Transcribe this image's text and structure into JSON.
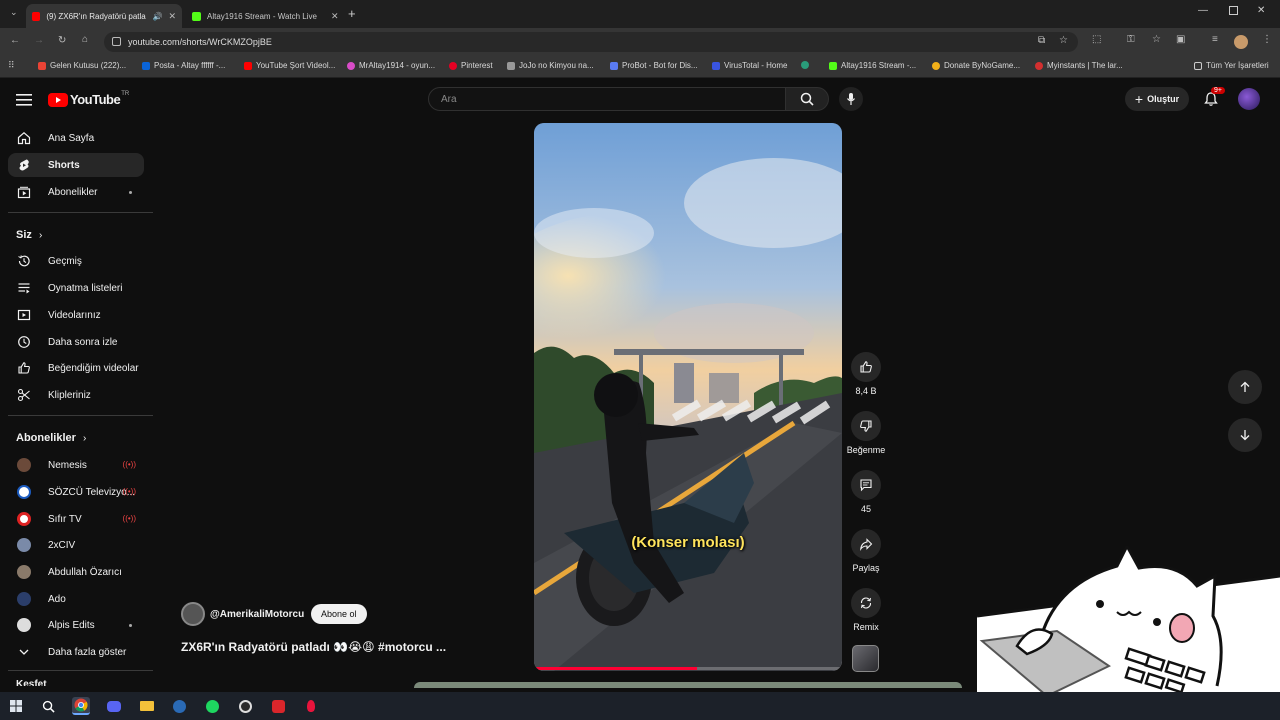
{
  "browser": {
    "tabs": [
      {
        "title": "(9) ZX6R'ın Radyatörü patla",
        "active": true
      },
      {
        "title": "Altay1916 Stream - Watch Live",
        "active": false
      }
    ],
    "url": "youtube.com/shorts/WrCKMZOpjBE",
    "bookmarks": [
      "Gelen Kutusu (222)...",
      "Posta - Altay ffffff -...",
      "YouTube Şort Videol...",
      "MrAltay1914 - oyun...",
      "Pinterest",
      "JoJo no Kimyou na...",
      "ProBot - Bot for Dis...",
      "VirusTotal - Home",
      "",
      "Altay1916 Stream -...",
      "Donate ByNoGame...",
      "Myinstants | The lar...",
      "Tüm Yer İşaretleri"
    ]
  },
  "youtube": {
    "logo": "YouTube",
    "country": "TR",
    "search_placeholder": "Ara",
    "create_label": "Oluştur",
    "notif_badge": "9+",
    "sidebar": {
      "main": [
        "Ana Sayfa",
        "Shorts",
        "Abonelikler"
      ],
      "you_header": "Siz",
      "you": [
        "Geçmiş",
        "Oynatma listeleri",
        "Videolarınız",
        "Daha sonra izle",
        "Beğendiğim videolar",
        "Klipleriniz"
      ],
      "subs_header": "Abonelikler",
      "subs": [
        "Nemesis",
        "SÖZCÜ Televizyo...",
        "Sıfır TV",
        "2xCIV",
        "Abdullah Özarıcı",
        "Ado",
        "Alpis Edits"
      ],
      "show_more": "Daha fazla göster",
      "explore_header": "Keşfet"
    },
    "short": {
      "channel": "@AmerikaliMotorcu",
      "subscribe": "Abone ol",
      "title": "ZX6R'ın Radyatörü patladı 👀😭😩  #motorcu ...",
      "caption": "(Konser molası)",
      "likes": "8,4 B",
      "dislike_label": "Beğenme",
      "comments": "45",
      "share_label": "Paylaş",
      "remix_label": "Remix",
      "progress": 0.53
    }
  }
}
